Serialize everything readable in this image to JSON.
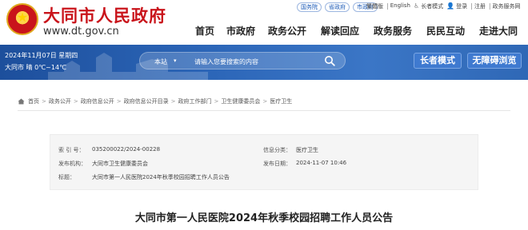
{
  "site": {
    "title": "大同市人民政府",
    "url": "www.dt.gov.cn"
  },
  "top_tags": [
    "国务院",
    "省政府",
    "市政府"
  ],
  "top_links": [
    "繁體版",
    "English",
    "长者模式",
    "登录",
    "注册",
    "政务服务网"
  ],
  "nav": [
    "首页",
    "市政府",
    "政务公开",
    "解读回应",
    "政务服务",
    "民民互动",
    "走进大同"
  ],
  "banner": {
    "date": "2024年11月07日 星期四",
    "weather": "大同市 晴 0℃~14℃",
    "search_scope": "本站",
    "search_placeholder": "请输入您要搜索的内容",
    "elder_mode": "长者模式",
    "accessible": "无障碍浏览"
  },
  "breadcrumb": [
    "首页",
    "政务公开",
    "政府信息公开",
    "政府信息公开目录",
    "政府工作部门",
    "卫生健康委员会",
    "医疗卫生"
  ],
  "info": {
    "index_label": "索 引 号：",
    "index_value": "035200022/2024-00228",
    "category_label": "信息分类：",
    "category_value": "医疗卫生",
    "issuer_label": "发布机构：",
    "issuer_value": "大同市卫生健康委员会",
    "date_label": "发布日期：",
    "date_value": "2024-11-07 10:46",
    "title_label": "标题：",
    "title_value": "大同市第一人民医院2024年秋季校园招聘工作人员公告"
  },
  "article_title": "大同市第一人民医院2024年秋季校园招聘工作人员公告",
  "colors": {
    "brand_red": "#c9141b",
    "banner_blue": "#2c66b8",
    "button_blue": "#3f7ad0"
  }
}
